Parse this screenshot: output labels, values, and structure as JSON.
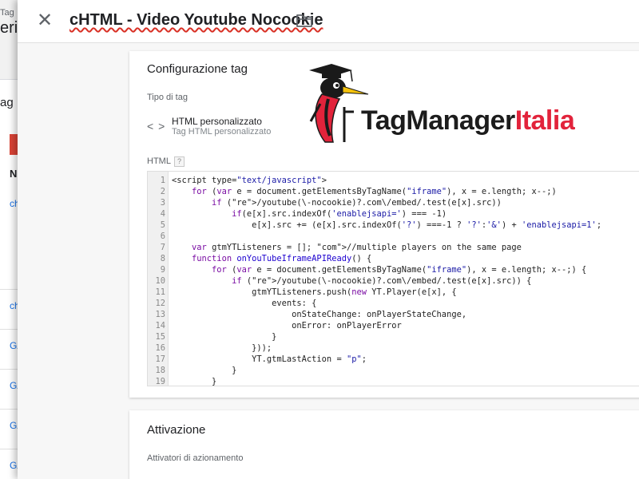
{
  "background": {
    "tag_label": "Tag",
    "title_fragment": "erit",
    "sub_fragment": "ag",
    "col_fragment": "N",
    "links": [
      "ch",
      "ch",
      "GA",
      "GA",
      "GA",
      "GA"
    ]
  },
  "header": {
    "close_icon": "close-icon",
    "tag_name": "cHTML - Video Youtube Nocookie",
    "folder_icon": "folder-icon"
  },
  "config": {
    "title": "Configurazione tag",
    "type_label": "Tipo di tag",
    "type_icon": "code-icon",
    "type_name": "HTML personalizzato",
    "type_sub": "Tag HTML personalizzato",
    "html_label": "HTML",
    "help_icon": "?"
  },
  "logo": {
    "text_part1": "TagManager",
    "text_part2": "Italia",
    "color_part1": "#1c1c1c",
    "color_part2": "#e2233b"
  },
  "code_lines": [
    {
      "n": "1",
      "t": "<script type=\"text/javascript\">"
    },
    {
      "n": "2",
      "t": "    for (var e = document.getElementsByTagName(\"iframe\"), x = e.length; x--;)"
    },
    {
      "n": "3",
      "t": "        if (/youtube(\\-nocookie)?.com\\/embed/.test(e[x].src))"
    },
    {
      "n": "4",
      "t": "            if(e[x].src.indexOf('enablejsapi=') === -1)"
    },
    {
      "n": "5",
      "t": "                e[x].src += (e[x].src.indexOf('?') ===-1 ? '?':'&') + 'enablejsapi=1';"
    },
    {
      "n": "6",
      "t": ""
    },
    {
      "n": "7",
      "t": "    var gtmYTListeners = []; //multiple players on the same page"
    },
    {
      "n": "8",
      "t": "    function onYouTubeIframeAPIReady() {"
    },
    {
      "n": "9",
      "t": "        for (var e = document.getElementsByTagName(\"iframe\"), x = e.length; x--;) {"
    },
    {
      "n": "10",
      "t": "            if (/youtube(\\-nocookie)?.com\\/embed/.test(e[x].src)) {"
    },
    {
      "n": "11",
      "t": "                gtmYTListeners.push(new YT.Player(e[x], {"
    },
    {
      "n": "12",
      "t": "                    events: {"
    },
    {
      "n": "13",
      "t": "                        onStateChange: onPlayerStateChange,"
    },
    {
      "n": "14",
      "t": "                        onError: onPlayerError"
    },
    {
      "n": "15",
      "t": "                    }"
    },
    {
      "n": "16",
      "t": "                }));"
    },
    {
      "n": "17",
      "t": "                YT.gtmLastAction = \"p\";"
    },
    {
      "n": "18",
      "t": "            }"
    },
    {
      "n": "19",
      "t": "        }"
    }
  ],
  "activation": {
    "title": "Attivazione",
    "triggers_label": "Attivatori di azionamento"
  }
}
